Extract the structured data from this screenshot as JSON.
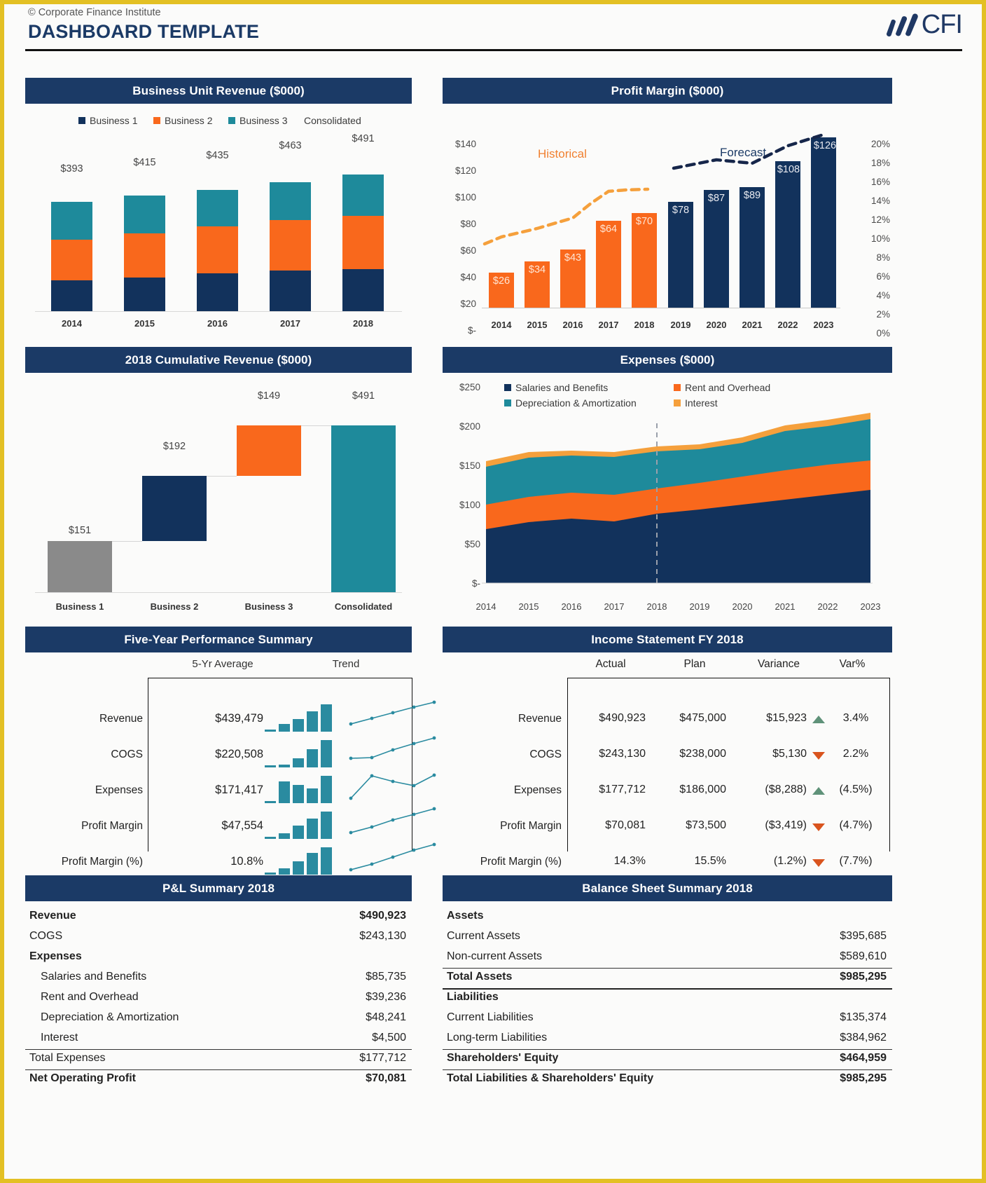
{
  "header": {
    "copyright": "© Corporate Finance Institute",
    "title": "DASHBOARD TEMPLATE",
    "logo_text": "CFI",
    "logo_icon": "cfi-bars-logo"
  },
  "panels": {
    "business_unit_revenue": {
      "title": "Business Unit Revenue ($000)"
    },
    "profit_margin": {
      "title": "Profit Margin ($000)"
    },
    "cumulative_revenue": {
      "title": "2018 Cumulative Revenue ($000)"
    },
    "expenses": {
      "title": "Expenses ($000)"
    },
    "five_year": {
      "title": "Five-Year Performance Summary"
    },
    "income_statement": {
      "title": "Income Statement FY 2018"
    },
    "pl_summary": {
      "title": "P&L Summary 2018"
    },
    "balance_sheet": {
      "title": "Balance Sheet Summary 2018"
    }
  },
  "chart_data": [
    {
      "id": "business_unit_revenue",
      "type": "bar",
      "stacked": true,
      "title": "Business Unit Revenue ($000)",
      "categories": [
        "2014",
        "2015",
        "2016",
        "2017",
        "2018"
      ],
      "series": [
        {
          "name": "Business 1",
          "color": "#12325c",
          "values": [
            110,
            121,
            136,
            147,
            151
          ]
        },
        {
          "name": "Business 2",
          "color": "#f9681c",
          "values": [
            146,
            160,
            168,
            180,
            192
          ]
        },
        {
          "name": "Business 3",
          "color": "#1e8a9b",
          "values": [
            137,
            134,
            131,
            136,
            148
          ]
        }
      ],
      "totals": [
        "$393",
        "$415",
        "$435",
        "$463",
        "$491"
      ],
      "legend": [
        "Business 1",
        "Business 2",
        "Business 3",
        "Consolidated"
      ],
      "legend_extra": "Consolidated",
      "ylim": [
        0,
        500
      ],
      "grid": false
    },
    {
      "id": "profit_margin",
      "type": "bar",
      "title": "Profit Margin ($000)",
      "categories": [
        "2014",
        "2015",
        "2016",
        "2017",
        "2018",
        "2019",
        "2020",
        "2021",
        "2022",
        "2023"
      ],
      "values": [
        26,
        34,
        43,
        64,
        70,
        78,
        87,
        89,
        108,
        126
      ],
      "data_labels": [
        "$26",
        "$34",
        "$43",
        "$64",
        "$70",
        "$78",
        "$87",
        "$89",
        "$108",
        "$126"
      ],
      "bar_colors": [
        "#f9681c",
        "#f9681c",
        "#f9681c",
        "#f9681c",
        "#f9681c",
        "#12325c",
        "#12325c",
        "#12325c",
        "#12325c",
        "#12325c"
      ],
      "annotations": [
        {
          "text": "Historical",
          "color": "#f08030"
        },
        {
          "text": "Forecast",
          "color": "#1b3a66"
        }
      ],
      "line_series": [
        {
          "name": "Historical margin %",
          "color": "#f5a03c",
          "style": "dashed",
          "values_pct": [
            6.6,
            8.2,
            9.6,
            13.6,
            14.3
          ]
        },
        {
          "name": "Forecast margin %",
          "color": "#16264a",
          "style": "dashed",
          "values_pct": [
            15.2,
            16.2,
            15.8,
            17.6,
            19.0
          ]
        }
      ],
      "y_left_ticks": [
        "$140",
        "$120",
        "$100",
        "$80",
        "$60",
        "$40",
        "$20",
        "$-"
      ],
      "y_right_ticks": [
        "20%",
        "18%",
        "16%",
        "14%",
        "12%",
        "10%",
        "8%",
        "6%",
        "4%",
        "2%",
        "0%"
      ],
      "ylim": [
        0,
        140
      ],
      "y2lim": [
        0,
        20
      ]
    },
    {
      "id": "cumulative_revenue",
      "type": "bar",
      "waterfall": true,
      "title": "2018 Cumulative Revenue ($000)",
      "categories": [
        "Business 1",
        "Business 2",
        "Business 3",
        "Consolidated"
      ],
      "values": [
        151,
        192,
        149,
        491
      ],
      "data_labels": [
        "$151",
        "$192",
        "$149",
        "$491"
      ],
      "bases": [
        0,
        151,
        343,
        0
      ],
      "bar_colors": [
        "#8a8a8a",
        "#12325c",
        "#f9681c",
        "#1e8a9b"
      ],
      "ylim": [
        0,
        520
      ]
    },
    {
      "id": "expenses",
      "type": "area",
      "stacked": true,
      "title": "Expenses ($000)",
      "categories": [
        "2014",
        "2015",
        "2016",
        "2017",
        "2018",
        "2019",
        "2020",
        "2021",
        "2022",
        "2023"
      ],
      "series": [
        {
          "name": "Salaries and Benefits",
          "color": "#12325c",
          "values": [
            69,
            78,
            82,
            79,
            88,
            94,
            100,
            106,
            112,
            119
          ]
        },
        {
          "name": "Rent and Overhead",
          "color": "#f9681c",
          "values": [
            31,
            34,
            34,
            36,
            38,
            38,
            39,
            41,
            42,
            43
          ]
        },
        {
          "name": "Depreciation & Amortization",
          "color": "#1e8a9b",
          "values": [
            50,
            50,
            47,
            48,
            47,
            43,
            46,
            50,
            49,
            53
          ]
        },
        {
          "name": "Interest",
          "color": "#f5a03c",
          "values": [
            7,
            7,
            6,
            6,
            6,
            6,
            7,
            7,
            8,
            8
          ]
        }
      ],
      "y_ticks": [
        "$250",
        "$200",
        "$150",
        "$100",
        "$50",
        "$-"
      ],
      "ylim": [
        0,
        250
      ],
      "forecast_divider_after": "2018",
      "legend_position": "top"
    }
  ],
  "five_year_summary": {
    "columns": [
      "",
      "5-Yr Average",
      "Trend"
    ],
    "col_avg_label": "5-Yr Average",
    "col_trend_label": "Trend",
    "rows": [
      {
        "label": "Revenue",
        "average": "$439,479",
        "sparkbars": [
          2,
          22,
          38,
          62,
          84
        ],
        "sparkline": [
          18,
          36,
          52,
          70,
          88
        ]
      },
      {
        "label": "COGS",
        "average": "$220,508",
        "sparkbars": [
          2,
          3,
          28,
          56,
          84
        ],
        "sparkline": [
          12,
          14,
          46,
          66,
          88
        ]
      },
      {
        "label": "Expenses",
        "average": "$171,417",
        "sparkbars": [
          3,
          66,
          54,
          44,
          84
        ],
        "sparkline": [
          6,
          74,
          62,
          55,
          86
        ]
      },
      {
        "label": "Profit Margin",
        "average": "$47,554",
        "sparkbars": [
          2,
          16,
          40,
          64,
          86
        ],
        "sparkline": [
          14,
          30,
          52,
          68,
          90
        ]
      },
      {
        "label": "Profit Margin (%)",
        "average": "10.8%",
        "sparkbars": [
          2,
          18,
          40,
          70,
          84
        ],
        "sparkline": [
          10,
          28,
          50,
          70,
          88
        ]
      }
    ]
  },
  "income_statement": {
    "columns": [
      "Actual",
      "Plan",
      "Variance",
      "Var%"
    ],
    "rows": [
      {
        "label": "Revenue",
        "actual": "$490,923",
        "plan": "$475,000",
        "variance": "$15,923",
        "indicator": "up",
        "var_pct": "3.4%"
      },
      {
        "label": "COGS",
        "actual": "$243,130",
        "plan": "$238,000",
        "variance": "$5,130",
        "indicator": "down",
        "var_pct": "2.2%"
      },
      {
        "label": "Expenses",
        "actual": "$177,712",
        "plan": "$186,000",
        "variance": "($8,288)",
        "indicator": "up",
        "var_pct": "(4.5%)"
      },
      {
        "label": "Profit Margin",
        "actual": "$70,081",
        "plan": "$73,500",
        "variance": "($3,419)",
        "indicator": "down",
        "var_pct": "(4.7%)"
      },
      {
        "label": "Profit Margin (%)",
        "actual": "14.3%",
        "plan": "15.5%",
        "variance": "(1.2%)",
        "indicator": "down",
        "var_pct": "(7.7%)"
      }
    ]
  },
  "pl_summary": {
    "rows": [
      {
        "name": "Revenue",
        "amount": "$490,923",
        "bold": true,
        "indent": 0,
        "rule": "none"
      },
      {
        "name": "COGS",
        "amount": "$243,130",
        "bold": false,
        "indent": 0,
        "rule": "none"
      },
      {
        "name": "Expenses",
        "amount": "",
        "bold": true,
        "indent": 0,
        "rule": "none"
      },
      {
        "name": "Salaries and Benefits",
        "amount": "$85,735",
        "bold": false,
        "indent": 1,
        "rule": "none"
      },
      {
        "name": "Rent and Overhead",
        "amount": "$39,236",
        "bold": false,
        "indent": 1,
        "rule": "none"
      },
      {
        "name": "Depreciation & Amortization",
        "amount": "$48,241",
        "bold": false,
        "indent": 1,
        "rule": "none"
      },
      {
        "name": "Interest",
        "amount": "$4,500",
        "bold": false,
        "indent": 1,
        "rule": "under"
      },
      {
        "name": "Total Expenses",
        "amount": "$177,712",
        "bold": false,
        "indent": 0,
        "rule": "under"
      },
      {
        "name": "Net Operating Profit",
        "amount": "$70,081",
        "bold": true,
        "indent": 0,
        "rule": "none"
      }
    ]
  },
  "balance_sheet": {
    "rows": [
      {
        "name": "Assets",
        "amount": "",
        "bold": true,
        "rule": "none"
      },
      {
        "name": "Current Assets",
        "amount": "$395,685",
        "bold": false,
        "rule": "none"
      },
      {
        "name": "Non-current Assets",
        "amount": "$589,610",
        "bold": false,
        "rule": "under"
      },
      {
        "name": "Total Assets",
        "amount": "$985,295",
        "bold": true,
        "rule": "under"
      },
      {
        "name": "Liabilities",
        "amount": "",
        "bold": true,
        "rule": "none"
      },
      {
        "name": "Current Liabilities",
        "amount": "$135,374",
        "bold": false,
        "rule": "none"
      },
      {
        "name": "Long-term Liabilities",
        "amount": "$384,962",
        "bold": false,
        "rule": "under"
      },
      {
        "name": "Shareholders' Equity",
        "amount": "$464,959",
        "bold": true,
        "rule": "under"
      },
      {
        "name": "Total Liabilities & Shareholders' Equity",
        "amount": "$985,295",
        "bold": true,
        "rule": "none"
      }
    ]
  },
  "colors": {
    "navy": "#1b3a66",
    "dark_navy": "#12325c",
    "orange": "#f9681c",
    "teal": "#1e8a9b",
    "amber": "#f5a03c",
    "gray": "#8a8a8a",
    "green_up": "#5f9279",
    "red_down": "#d9541e",
    "border_gold": "#e3c024"
  }
}
